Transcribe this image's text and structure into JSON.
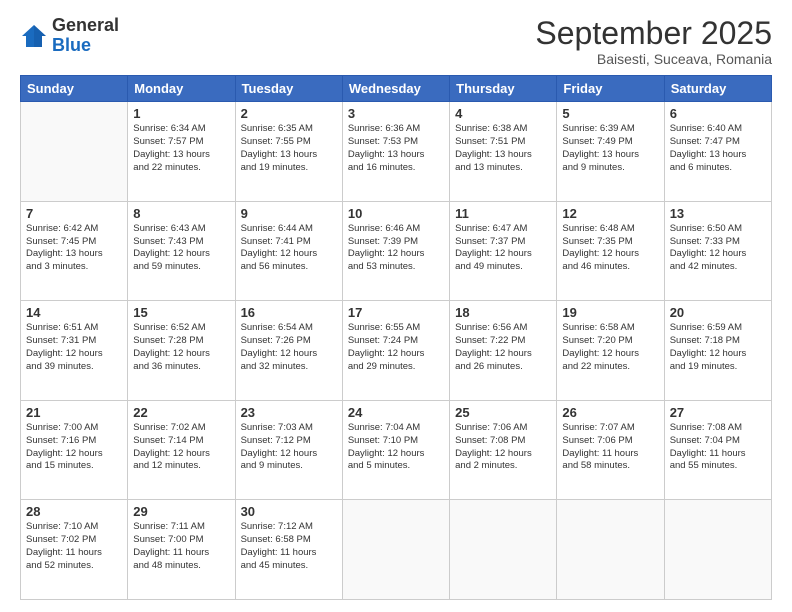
{
  "header": {
    "logo_line1": "General",
    "logo_line2": "Blue",
    "month": "September 2025",
    "location": "Baisesti, Suceava, Romania"
  },
  "weekdays": [
    "Sunday",
    "Monday",
    "Tuesday",
    "Wednesday",
    "Thursday",
    "Friday",
    "Saturday"
  ],
  "weeks": [
    [
      {
        "day": "",
        "info": ""
      },
      {
        "day": "1",
        "info": "Sunrise: 6:34 AM\nSunset: 7:57 PM\nDaylight: 13 hours\nand 22 minutes."
      },
      {
        "day": "2",
        "info": "Sunrise: 6:35 AM\nSunset: 7:55 PM\nDaylight: 13 hours\nand 19 minutes."
      },
      {
        "day": "3",
        "info": "Sunrise: 6:36 AM\nSunset: 7:53 PM\nDaylight: 13 hours\nand 16 minutes."
      },
      {
        "day": "4",
        "info": "Sunrise: 6:38 AM\nSunset: 7:51 PM\nDaylight: 13 hours\nand 13 minutes."
      },
      {
        "day": "5",
        "info": "Sunrise: 6:39 AM\nSunset: 7:49 PM\nDaylight: 13 hours\nand 9 minutes."
      },
      {
        "day": "6",
        "info": "Sunrise: 6:40 AM\nSunset: 7:47 PM\nDaylight: 13 hours\nand 6 minutes."
      }
    ],
    [
      {
        "day": "7",
        "info": "Sunrise: 6:42 AM\nSunset: 7:45 PM\nDaylight: 13 hours\nand 3 minutes."
      },
      {
        "day": "8",
        "info": "Sunrise: 6:43 AM\nSunset: 7:43 PM\nDaylight: 12 hours\nand 59 minutes."
      },
      {
        "day": "9",
        "info": "Sunrise: 6:44 AM\nSunset: 7:41 PM\nDaylight: 12 hours\nand 56 minutes."
      },
      {
        "day": "10",
        "info": "Sunrise: 6:46 AM\nSunset: 7:39 PM\nDaylight: 12 hours\nand 53 minutes."
      },
      {
        "day": "11",
        "info": "Sunrise: 6:47 AM\nSunset: 7:37 PM\nDaylight: 12 hours\nand 49 minutes."
      },
      {
        "day": "12",
        "info": "Sunrise: 6:48 AM\nSunset: 7:35 PM\nDaylight: 12 hours\nand 46 minutes."
      },
      {
        "day": "13",
        "info": "Sunrise: 6:50 AM\nSunset: 7:33 PM\nDaylight: 12 hours\nand 42 minutes."
      }
    ],
    [
      {
        "day": "14",
        "info": "Sunrise: 6:51 AM\nSunset: 7:31 PM\nDaylight: 12 hours\nand 39 minutes."
      },
      {
        "day": "15",
        "info": "Sunrise: 6:52 AM\nSunset: 7:28 PM\nDaylight: 12 hours\nand 36 minutes."
      },
      {
        "day": "16",
        "info": "Sunrise: 6:54 AM\nSunset: 7:26 PM\nDaylight: 12 hours\nand 32 minutes."
      },
      {
        "day": "17",
        "info": "Sunrise: 6:55 AM\nSunset: 7:24 PM\nDaylight: 12 hours\nand 29 minutes."
      },
      {
        "day": "18",
        "info": "Sunrise: 6:56 AM\nSunset: 7:22 PM\nDaylight: 12 hours\nand 26 minutes."
      },
      {
        "day": "19",
        "info": "Sunrise: 6:58 AM\nSunset: 7:20 PM\nDaylight: 12 hours\nand 22 minutes."
      },
      {
        "day": "20",
        "info": "Sunrise: 6:59 AM\nSunset: 7:18 PM\nDaylight: 12 hours\nand 19 minutes."
      }
    ],
    [
      {
        "day": "21",
        "info": "Sunrise: 7:00 AM\nSunset: 7:16 PM\nDaylight: 12 hours\nand 15 minutes."
      },
      {
        "day": "22",
        "info": "Sunrise: 7:02 AM\nSunset: 7:14 PM\nDaylight: 12 hours\nand 12 minutes."
      },
      {
        "day": "23",
        "info": "Sunrise: 7:03 AM\nSunset: 7:12 PM\nDaylight: 12 hours\nand 9 minutes."
      },
      {
        "day": "24",
        "info": "Sunrise: 7:04 AM\nSunset: 7:10 PM\nDaylight: 12 hours\nand 5 minutes."
      },
      {
        "day": "25",
        "info": "Sunrise: 7:06 AM\nSunset: 7:08 PM\nDaylight: 12 hours\nand 2 minutes."
      },
      {
        "day": "26",
        "info": "Sunrise: 7:07 AM\nSunset: 7:06 PM\nDaylight: 11 hours\nand 58 minutes."
      },
      {
        "day": "27",
        "info": "Sunrise: 7:08 AM\nSunset: 7:04 PM\nDaylight: 11 hours\nand 55 minutes."
      }
    ],
    [
      {
        "day": "28",
        "info": "Sunrise: 7:10 AM\nSunset: 7:02 PM\nDaylight: 11 hours\nand 52 minutes."
      },
      {
        "day": "29",
        "info": "Sunrise: 7:11 AM\nSunset: 7:00 PM\nDaylight: 11 hours\nand 48 minutes."
      },
      {
        "day": "30",
        "info": "Sunrise: 7:12 AM\nSunset: 6:58 PM\nDaylight: 11 hours\nand 45 minutes."
      },
      {
        "day": "",
        "info": ""
      },
      {
        "day": "",
        "info": ""
      },
      {
        "day": "",
        "info": ""
      },
      {
        "day": "",
        "info": ""
      }
    ]
  ]
}
